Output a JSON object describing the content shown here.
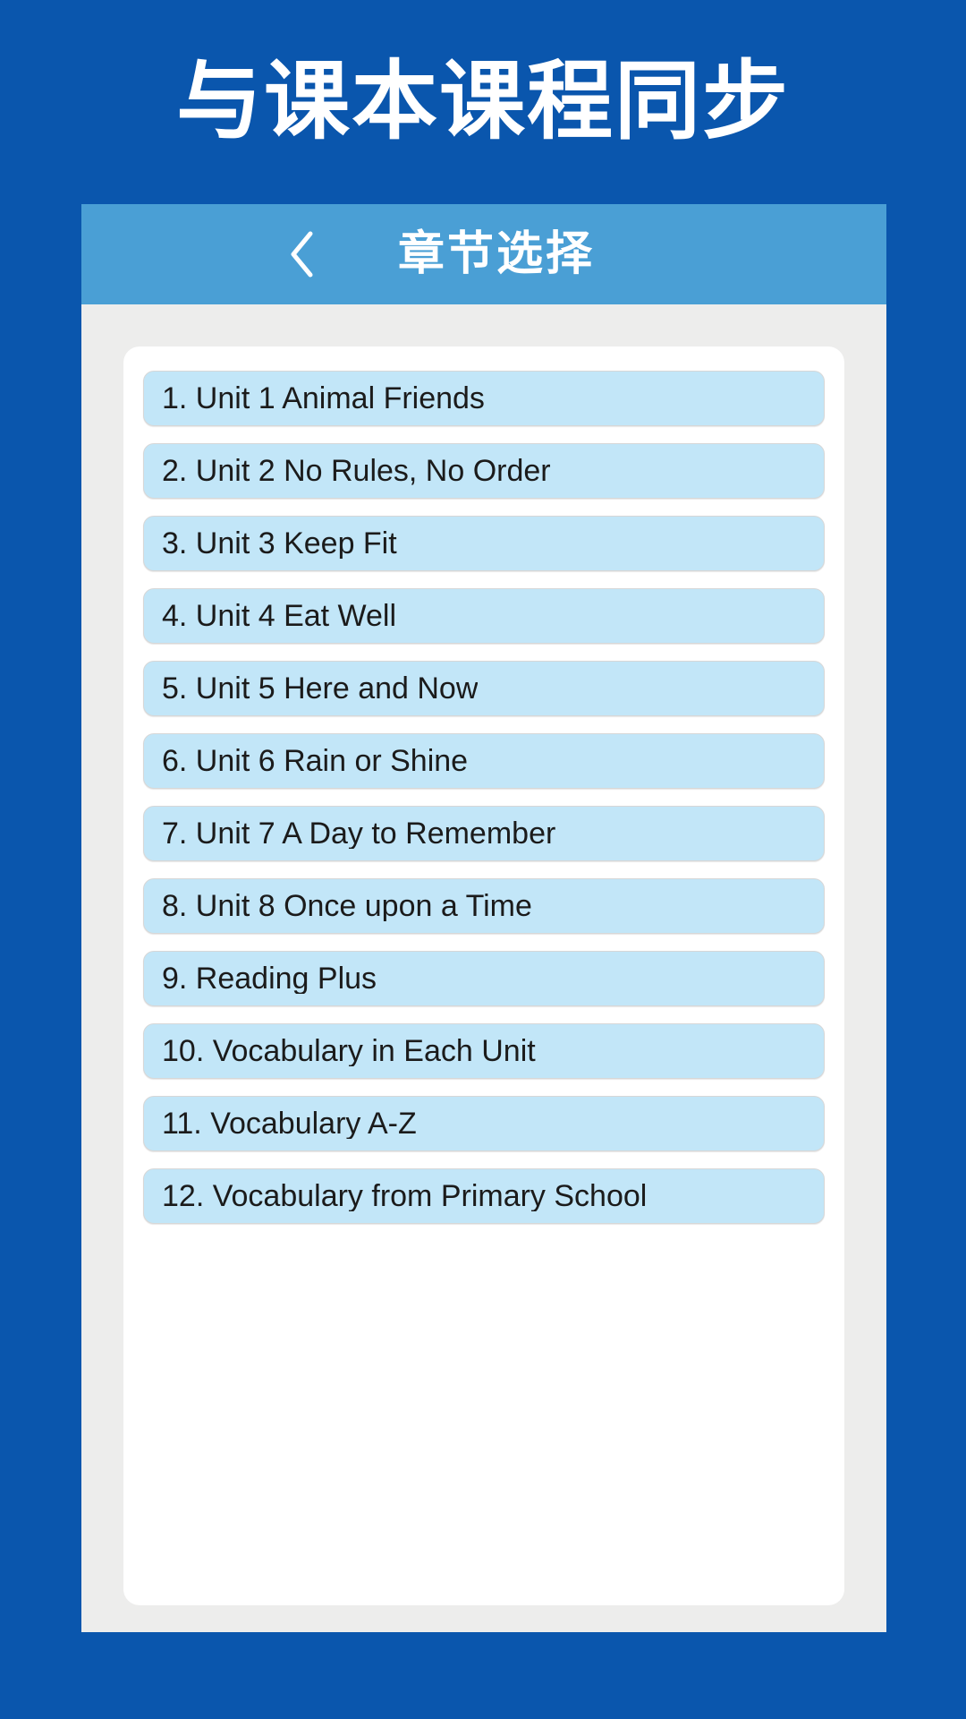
{
  "promo": {
    "headline": "与课本课程同步"
  },
  "nav": {
    "back_icon": "chevron-left-icon",
    "title": "章节选择"
  },
  "colors": {
    "page_background": "#0a56ad",
    "frame_background": "#ededec",
    "nav_bar": "#4a9fd5",
    "card_background": "#ffffff",
    "item_background": "#c2e6f8",
    "item_border": "#d7d7d7",
    "item_text": "#1b1b1b",
    "nav_text": "#ffffff",
    "headline_text": "#ffffff"
  },
  "chapters": {
    "items": [
      {
        "label": "1. Unit 1 Animal Friends"
      },
      {
        "label": "2. Unit 2 No Rules, No Order"
      },
      {
        "label": "3. Unit 3 Keep Fit"
      },
      {
        "label": "4. Unit 4 Eat Well"
      },
      {
        "label": "5. Unit 5 Here and Now"
      },
      {
        "label": "6. Unit 6 Rain or Shine"
      },
      {
        "label": "7. Unit 7 A Day to Remember"
      },
      {
        "label": "8. Unit 8 Once upon a Time"
      },
      {
        "label": "9. Reading Plus"
      },
      {
        "label": "10. Vocabulary in Each Unit"
      },
      {
        "label": "11. Vocabulary A-Z"
      },
      {
        "label": "12. Vocabulary from Primary School"
      }
    ]
  }
}
